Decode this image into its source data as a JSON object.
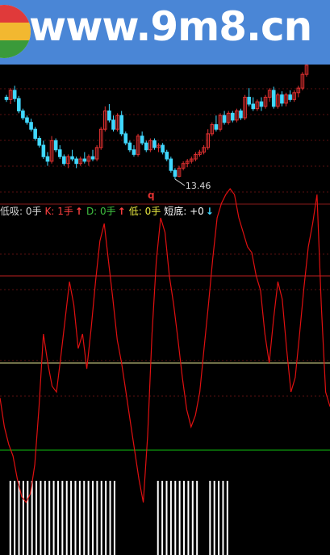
{
  "banner": {
    "text": "www.9m8.cn"
  },
  "price_panel": {
    "min_price_label": "13.46",
    "marker_label": "q"
  },
  "indicator_bar": {
    "items": [
      {
        "label": "低吸: 0手",
        "color": "#d8d8d8",
        "arrow": ""
      },
      {
        "label": "K: 1手",
        "color": "#ff4040",
        "arrow": "up"
      },
      {
        "label": "D: 0手",
        "color": "#40c040",
        "arrow": "up"
      },
      {
        "label": "低: 0手",
        "color": "#e8e840",
        "arrow": ""
      },
      {
        "label": "短底: +0",
        "color": "#ffffff",
        "arrow": "down"
      }
    ]
  },
  "colors": {
    "background": "#000000",
    "banner": "#4a86d6",
    "up_candle": "#e03030",
    "down_candle": "#40d8ff",
    "osc_line": "#e01010",
    "level_high": "#c02020",
    "level_mid": "#e0e090",
    "level_low": "#10c010",
    "signal_bar": "#ffffff"
  },
  "chart_data": [
    {
      "type": "candlestick",
      "title": "",
      "xlabel": "",
      "ylabel": "",
      "min_label": "13.46",
      "ohlc": [
        [
          15.25,
          15.3,
          15.15,
          15.2
        ],
        [
          15.2,
          15.45,
          15.1,
          15.4
        ],
        [
          15.4,
          15.5,
          15.15,
          15.22
        ],
        [
          15.22,
          15.28,
          14.9,
          14.95
        ],
        [
          14.95,
          15.0,
          14.75,
          14.8
        ],
        [
          14.8,
          14.85,
          14.65,
          14.7
        ],
        [
          14.7,
          14.78,
          14.5,
          14.55
        ],
        [
          14.55,
          14.6,
          14.3,
          14.35
        ],
        [
          14.35,
          14.4,
          14.15,
          14.2
        ],
        [
          14.2,
          14.3,
          13.9,
          13.95
        ],
        [
          13.95,
          14.05,
          13.75,
          13.85
        ],
        [
          13.85,
          14.4,
          13.8,
          14.3
        ],
        [
          14.3,
          14.35,
          14.05,
          14.1
        ],
        [
          14.1,
          14.2,
          13.9,
          13.95
        ],
        [
          13.95,
          14.0,
          13.75,
          13.8
        ],
        [
          13.8,
          14.0,
          13.7,
          13.95
        ],
        [
          13.95,
          14.1,
          13.85,
          13.9
        ],
        [
          13.9,
          13.95,
          13.7,
          13.8
        ],
        [
          13.8,
          13.95,
          13.75,
          13.9
        ],
        [
          13.9,
          14.05,
          13.8,
          13.85
        ],
        [
          13.85,
          14.0,
          13.75,
          13.95
        ],
        [
          13.95,
          14.1,
          13.85,
          13.9
        ],
        [
          13.9,
          14.2,
          13.85,
          14.15
        ],
        [
          14.15,
          14.6,
          14.1,
          14.55
        ],
        [
          14.55,
          15.05,
          14.5,
          14.95
        ],
        [
          14.95,
          15.1,
          14.7,
          14.75
        ],
        [
          14.75,
          14.85,
          14.5,
          14.55
        ],
        [
          14.55,
          14.9,
          14.5,
          14.85
        ],
        [
          14.85,
          14.95,
          14.4,
          14.45
        ],
        [
          14.45,
          14.5,
          14.2,
          14.25
        ],
        [
          14.25,
          14.3,
          14.05,
          14.1
        ],
        [
          14.1,
          14.2,
          13.95,
          14.0
        ],
        [
          14.0,
          14.45,
          13.95,
          14.4
        ],
        [
          14.4,
          14.5,
          14.2,
          14.25
        ],
        [
          14.25,
          14.3,
          14.05,
          14.1
        ],
        [
          14.1,
          14.35,
          14.05,
          14.3
        ],
        [
          14.3,
          14.35,
          14.1,
          14.15
        ],
        [
          14.15,
          14.25,
          14.05,
          14.2
        ],
        [
          14.2,
          14.25,
          14.0,
          14.05
        ],
        [
          14.05,
          14.1,
          13.85,
          13.9
        ],
        [
          13.9,
          13.95,
          13.6,
          13.65
        ],
        [
          13.65,
          13.7,
          13.46,
          13.52
        ],
        [
          13.52,
          13.75,
          13.5,
          13.7
        ],
        [
          13.7,
          13.85,
          13.65,
          13.8
        ],
        [
          13.8,
          13.9,
          13.72,
          13.85
        ],
        [
          13.85,
          13.95,
          13.8,
          13.9
        ],
        [
          13.9,
          14.05,
          13.85,
          14.0
        ],
        [
          14.0,
          14.1,
          13.95,
          14.05
        ],
        [
          14.05,
          14.2,
          14.0,
          14.15
        ],
        [
          14.15,
          14.55,
          14.1,
          14.45
        ],
        [
          14.45,
          14.7,
          14.4,
          14.65
        ],
        [
          14.65,
          14.85,
          14.5,
          14.55
        ],
        [
          14.55,
          14.9,
          14.5,
          14.85
        ],
        [
          14.85,
          14.95,
          14.65,
          14.7
        ],
        [
          14.7,
          14.95,
          14.65,
          14.9
        ],
        [
          14.9,
          14.95,
          14.7,
          14.75
        ],
        [
          14.75,
          15.0,
          14.7,
          14.95
        ],
        [
          14.95,
          15.0,
          14.75,
          14.8
        ],
        [
          14.8,
          15.3,
          14.75,
          15.25
        ],
        [
          15.25,
          15.45,
          15.05,
          15.1
        ],
        [
          15.1,
          15.25,
          14.95,
          15.0
        ],
        [
          15.0,
          15.2,
          14.95,
          15.15
        ],
        [
          15.15,
          15.25,
          14.95,
          15.05
        ],
        [
          15.05,
          15.3,
          15.0,
          15.25
        ],
        [
          15.25,
          15.45,
          15.15,
          15.4
        ],
        [
          15.4,
          15.48,
          15.0,
          15.05
        ],
        [
          15.05,
          15.35,
          15.0,
          15.3
        ],
        [
          15.3,
          15.38,
          15.05,
          15.12
        ],
        [
          15.12,
          15.35,
          15.05,
          15.3
        ],
        [
          15.3,
          15.4,
          15.15,
          15.2
        ],
        [
          15.2,
          15.4,
          15.15,
          15.35
        ],
        [
          15.35,
          15.5,
          15.25,
          15.45
        ],
        [
          15.45,
          15.8,
          15.4,
          15.75
        ],
        [
          15.75,
          16.0,
          15.7,
          15.95
        ]
      ]
    },
    {
      "type": "line",
      "title": "",
      "xlabel": "",
      "ylabel": "",
      "ylim": [
        0,
        100
      ],
      "levels": [
        80,
        50,
        20
      ],
      "series": [
        {
          "values": [
            38,
            28,
            22,
            18,
            10,
            4,
            2,
            5,
            15,
            35,
            60,
            50,
            42,
            40,
            52,
            65,
            78,
            70,
            55,
            60,
            48,
            62,
            78,
            92,
            98,
            85,
            72,
            58,
            50,
            40,
            30,
            20,
            10,
            2,
            25,
            60,
            85,
            100,
            95,
            80,
            70,
            58,
            45,
            34,
            28,
            32,
            40,
            55,
            70,
            86,
            100,
            105,
            108,
            110,
            108,
            100,
            95,
            90,
            88,
            80,
            75,
            60,
            50,
            65,
            78,
            72,
            55,
            40,
            45,
            60,
            76,
            90,
            98,
            108,
            70,
            40,
            35
          ]
        }
      ],
      "signal_bars": [
        0,
        0,
        1,
        1,
        1,
        1,
        1,
        1,
        1,
        1,
        1,
        1,
        1,
        1,
        1,
        1,
        1,
        1,
        1,
        1,
        1,
        1,
        1,
        1,
        1,
        1,
        1,
        0,
        0,
        0,
        0,
        0,
        0,
        0,
        0,
        0,
        1,
        1,
        1,
        1,
        1,
        1,
        1,
        1,
        1,
        1,
        0,
        0,
        1,
        1,
        1,
        1,
        1,
        0,
        0,
        0,
        0,
        0,
        0,
        0,
        0,
        0,
        0,
        0,
        0,
        0,
        0,
        0,
        0,
        0,
        0,
        0,
        0,
        0,
        0,
        0,
        0
      ]
    }
  ]
}
